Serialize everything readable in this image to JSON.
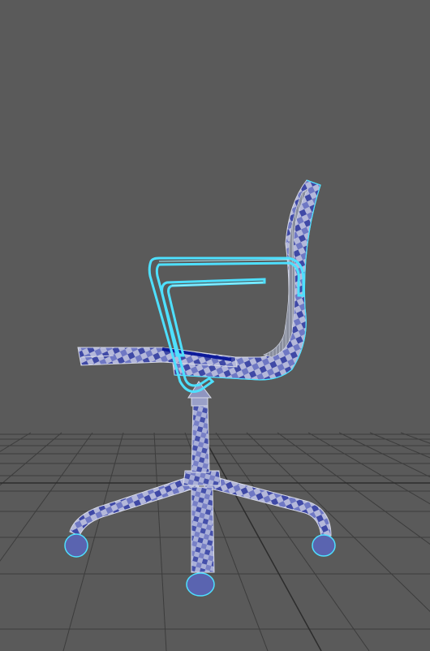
{
  "viewport": {
    "background_color": "#5a5a5a",
    "grid_color": "#3a3a3a",
    "grid_major_color": "#2a2a2a"
  },
  "model": {
    "selection_color": "#4ee0ff",
    "checker_dark": "#3f49a6",
    "checker_mid": "#6f78c4",
    "checker_light": "#b4b8da",
    "wire_color": "#d8dbe8",
    "accent_dark": "#0c1a99"
  }
}
